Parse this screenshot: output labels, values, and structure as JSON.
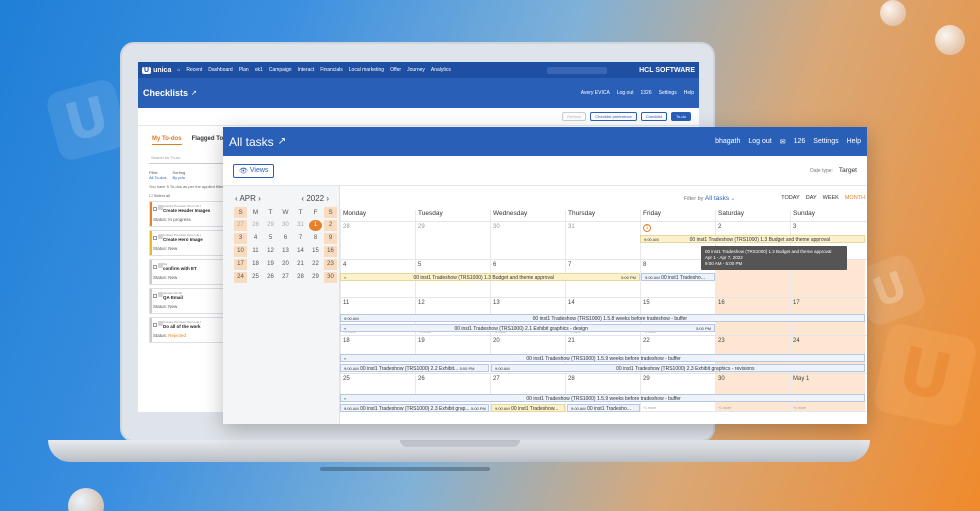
{
  "back_app": {
    "logo": "unica",
    "nav": [
      "Recent",
      "Dashboard",
      "Plan",
      "ok1",
      "Campaign",
      "Interact",
      "Financials",
      "Local marketing",
      "Offer",
      "Journey",
      "Analytics"
    ],
    "brand": "HCL SOFTWARE",
    "title": "Checklists",
    "user_links": [
      "Avery EVICA",
      "Log out",
      "1326",
      "Settings",
      "Help"
    ],
    "toolbar": [
      "Refresh",
      "Checklist preference",
      "Checklist",
      "To-do"
    ],
    "tabs": [
      "My To-dos",
      "Flagged To"
    ],
    "search_placeholder": "Search for To-do",
    "filter_label": "Filter",
    "filter_value": "All To-dos",
    "sort_label": "Sorting",
    "sort_value": "By prio",
    "note": "You have 5 To-dos as per the applied filter",
    "select_all": "Select all",
    "todos": [
      {
        "meta": "Unicare Premium Term Life I",
        "name": "Create Header Images",
        "status_label": "Status:",
        "status": "In progress",
        "color": "#e8802a"
      },
      {
        "meta": "Unicare Premium Term Life I",
        "name": "Create Hero Image",
        "status_label": "Status:",
        "status": "New",
        "color": "#e8b92a"
      },
      {
        "meta": "NA",
        "name": "confirm with ET",
        "status_label": "Status:",
        "status": "New",
        "color": "#c9cdd3"
      },
      {
        "meta": "January Email",
        "name": "QA Email",
        "status_label": "Status:",
        "status": "New",
        "color": "#c9cdd3"
      },
      {
        "meta": "Unicare Premium Term Life I",
        "name": "Do all of the work",
        "status_label": "Status:",
        "status": "Rejected",
        "color": "#c9cdd3"
      }
    ]
  },
  "calendar": {
    "title": "All tasks",
    "user_links": {
      "user": "bhagath",
      "logout": "Log out",
      "count": "126",
      "settings": "Settings",
      "help": "Help"
    },
    "views_label": "Views",
    "date_type_label": "Date type:",
    "date_type_value": "Target",
    "mini": {
      "month": "APR",
      "year": "2022",
      "weekday_headers": [
        "S",
        "M",
        "T",
        "W",
        "T",
        "F",
        "S"
      ],
      "rows": [
        [
          "27",
          "28",
          "29",
          "30",
          "31",
          "1",
          "2"
        ],
        [
          "3",
          "4",
          "5",
          "6",
          "7",
          "8",
          "9"
        ],
        [
          "10",
          "11",
          "12",
          "13",
          "14",
          "15",
          "16"
        ],
        [
          "17",
          "18",
          "19",
          "20",
          "21",
          "22",
          "23"
        ],
        [
          "24",
          "25",
          "26",
          "27",
          "28",
          "29",
          "30"
        ]
      ]
    },
    "filter_label": "Filter by",
    "filter_value": "All tasks",
    "views": [
      "TODAY",
      "DAY",
      "WEEK",
      "MONTH"
    ],
    "weekdays": [
      "Monday",
      "Tuesday",
      "Wednesday",
      "Thursday",
      "Friday",
      "Saturday",
      "Sunday"
    ],
    "weeks": [
      {
        "days": [
          "28",
          "29",
          "30",
          "31",
          "1",
          "2",
          "3"
        ],
        "more": [
          "",
          "",
          "",
          "",
          "",
          "",
          ""
        ]
      },
      {
        "days": [
          "4",
          "5",
          "6",
          "7",
          "8",
          "9",
          "10"
        ],
        "more": [
          "",
          "",
          "",
          "",
          "",
          "",
          ""
        ]
      },
      {
        "days": [
          "11",
          "12",
          "13",
          "14",
          "15",
          "16",
          "17"
        ],
        "more": [
          "+1 more",
          "+1 more",
          "+1 more",
          "+1 more",
          "+1 more",
          "",
          ""
        ]
      },
      {
        "days": [
          "18",
          "19",
          "20",
          "21",
          "22",
          "23",
          "24"
        ],
        "more": [
          "+1 more",
          "+1 more",
          "+1 more",
          "+1 more",
          "+1 more",
          "+1 more",
          "+1 more"
        ]
      },
      {
        "days": [
          "25",
          "26",
          "27",
          "28",
          "29",
          "30",
          "May 1"
        ],
        "more": [
          "+1 more",
          "+1 more",
          "+1 more",
          "+1 more",
          "+1 more",
          "+1 more",
          "+1 more"
        ]
      }
    ],
    "events": {
      "e1_time": "9:00 AM",
      "e1_text": "00 inst1 Tradeshow (TRS1000) 1.3 Budget and theme approval",
      "e2_text": "00 inst1 Tradeshow (TRS1000) 1.3 Budget and theme approval",
      "e2_end": "5:00 PM",
      "e3_time": "9:00 AM",
      "e3_text": "00 inst1 Tradesho...",
      "e4_time": "9:00 AM",
      "e4_text": "00 inst1 Tradeshow (TRS1000) 1.5.8 weeks before tradeshow - buffer",
      "e5_text": "00 inst1 Tradeshow (TRS1000) 2.1 Exhibit graphics - design",
      "e5_end": "5:00 PM",
      "e6_text": "00 inst1 Tradeshow (TRS1000) 1.5.9 weeks before tradeshow - buffer",
      "e7_time": "9:00 AM",
      "e7_text": "00 inst1 Tradeshow (TRS1000) 2.2 Exhibit...",
      "e7_end": "5:00 PM",
      "e8_time": "9:00 AM",
      "e8_text": "00 inst1 Tradeshow (TRS1000) 2.3 Exhibit graphics - revisions",
      "e9_text": "00 inst1 Tradeshow (TRS1000) 1.5.9 weeks before tradeshow - buffer",
      "e10_time": "9:00 AM",
      "e10_text": "00 inst1 Tradeshow (TRS1000) 2.3 Exhibit grap...",
      "e10_end": "5:00 PM",
      "e11_time": "9:00 AM",
      "e11_text": "00 inst1 Tradeshow...",
      "e12_time": "9:00 AM",
      "e12_text": "00 inst1 Tradesho..."
    },
    "tooltip": {
      "line1": "00 inst1 Tradeshow (TRS1000) 1.3 Budget and theme approval",
      "line2": "Apr 1 - Apr 7, 2022",
      "line3": "9:00 AM - 5:00 PM"
    }
  }
}
